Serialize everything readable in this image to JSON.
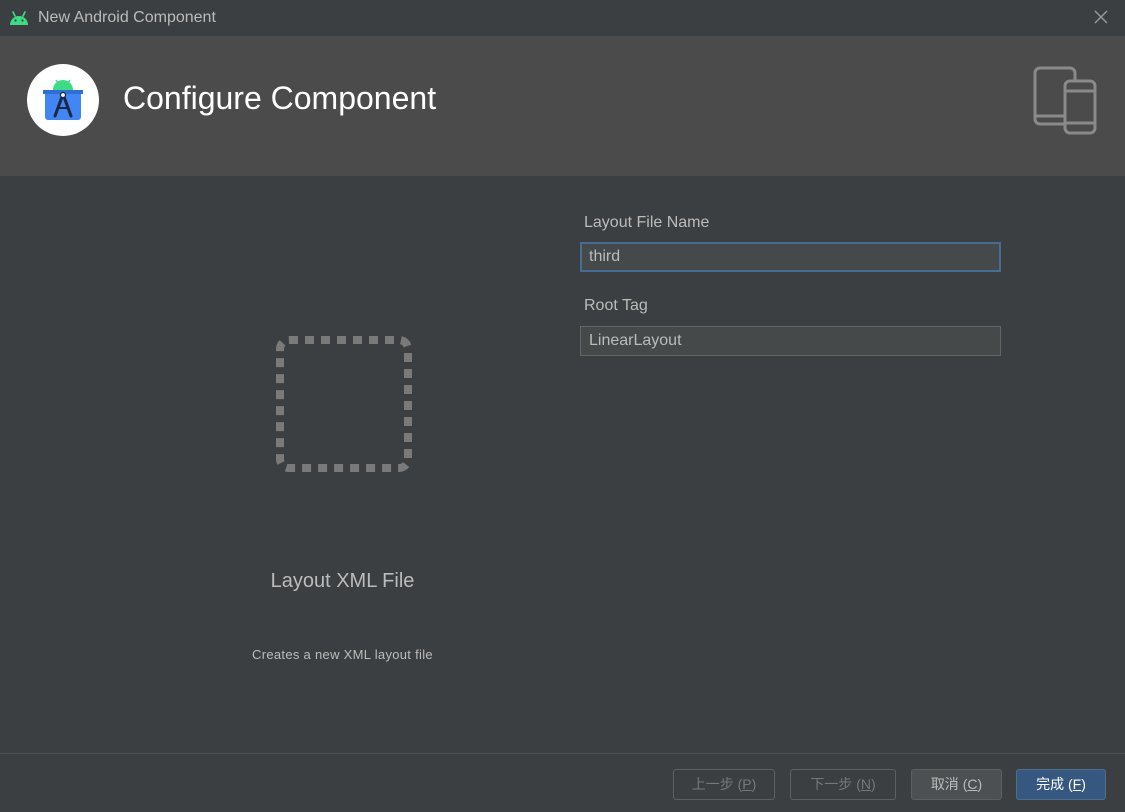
{
  "window": {
    "title": "New Android Component",
    "app_icon": "android-icon",
    "close_icon": "close-icon"
  },
  "header": {
    "title": "Configure Component",
    "logo_icon": "android-studio-logo-icon",
    "devices_icon": "tablet-phone-icon"
  },
  "preview": {
    "icon": "layout-placeholder-icon",
    "title": "Layout XML File",
    "description": "Creates a new XML layout file"
  },
  "form": {
    "layout_file_name": {
      "label": "Layout File Name",
      "value": "third"
    },
    "root_tag": {
      "label": "Root Tag",
      "value": "LinearLayout"
    }
  },
  "buttons": {
    "previous": {
      "label": "上一步 (",
      "mnemonic": "P",
      "suffix": ")"
    },
    "next": {
      "label": "下一步 (",
      "mnemonic": "N",
      "suffix": ")"
    },
    "cancel": {
      "label": "取消 (",
      "mnemonic": "C",
      "suffix": ")"
    },
    "finish": {
      "label": "完成 (",
      "mnemonic": "F",
      "suffix": ")"
    }
  },
  "colors": {
    "background": "#3c3f41",
    "header": "#4b4b4b",
    "accent": "#365880",
    "focus_border": "#466d94",
    "android_green": "#3ddc84"
  }
}
